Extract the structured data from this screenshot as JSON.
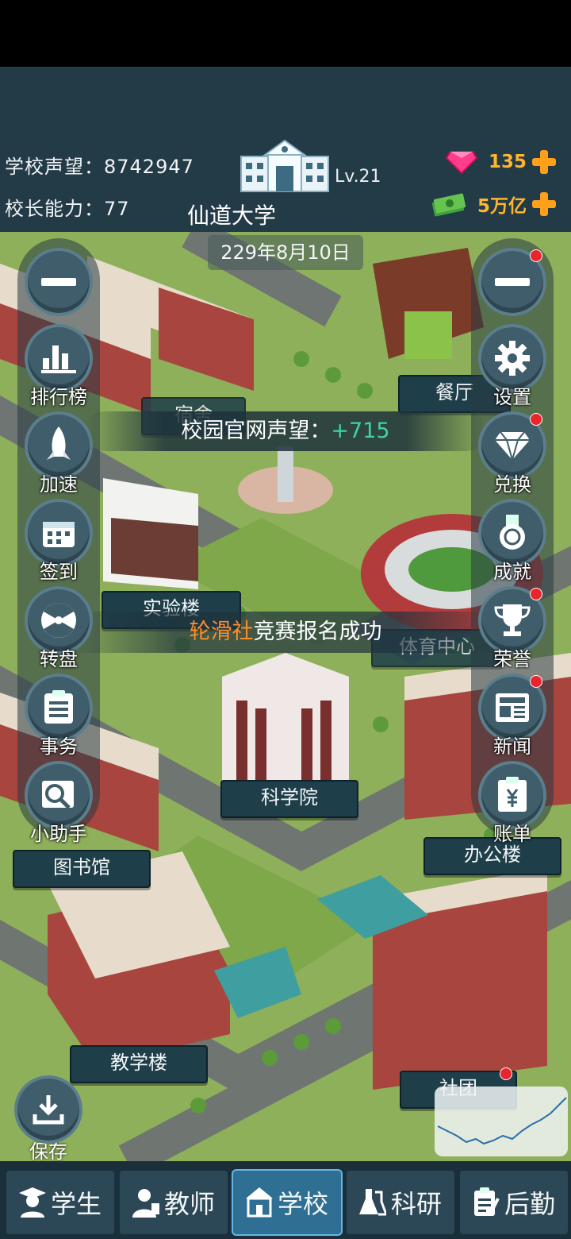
{
  "header": {
    "reputation_label": "学校声望：",
    "reputation_value": "8742947",
    "ability_label": "校长能力：",
    "ability_value": "77",
    "level": "Lv.21",
    "school_name": "仙道大学",
    "gems": "135",
    "money": "5万亿"
  },
  "date": "229年8月10日",
  "left_menu": [
    {
      "label": ""
    },
    {
      "label": "排行榜"
    },
    {
      "label": "加速"
    },
    {
      "label": "签到"
    },
    {
      "label": "转盘"
    },
    {
      "label": "事务"
    },
    {
      "label": "小助手"
    }
  ],
  "right_menu": [
    {
      "label": ""
    },
    {
      "label": "设置"
    },
    {
      "label": "兑换"
    },
    {
      "label": "成就"
    },
    {
      "label": "荣誉"
    },
    {
      "label": "新闻"
    },
    {
      "label": "账单"
    }
  ],
  "buildings": {
    "canteen": "餐厅",
    "dorm": "宿舍",
    "lab": "实验楼",
    "sports": "体育中心",
    "science": "科学院",
    "library": "图书馆",
    "office": "办公楼",
    "teaching": "教学楼",
    "club": "社团"
  },
  "notice_website": {
    "label": "校园官网声望：",
    "value": "+715"
  },
  "notice_event": {
    "highlight": "轮滑社",
    "text": "竞赛报名成功"
  },
  "save_label": "保存",
  "tabs": [
    {
      "label": "学生",
      "icon": "student-icon"
    },
    {
      "label": "教师",
      "icon": "teacher-icon"
    },
    {
      "label": "学校",
      "icon": "school-icon",
      "active": true
    },
    {
      "label": "科研",
      "icon": "flask-icon"
    },
    {
      "label": "后勤",
      "icon": "clipboard-icon"
    }
  ],
  "colors": {
    "accent": "#ffb52e",
    "positive": "#3fd4a5",
    "highlight": "#ff8c2a",
    "active_tab": "#2e6f93"
  }
}
